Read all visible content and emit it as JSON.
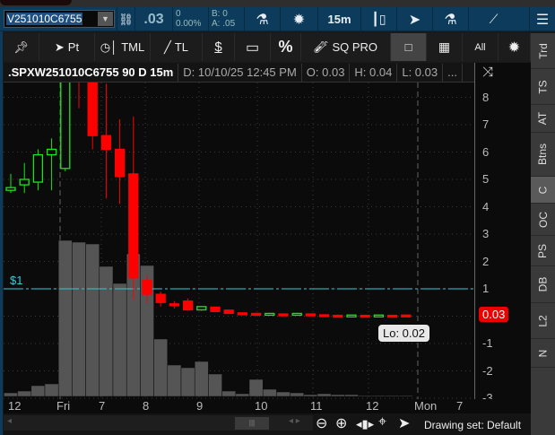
{
  "toolbar": {
    "symbol": "V251010C6755",
    "last": ".03",
    "change": "0",
    "change_pct": "0.00%",
    "bid": "B: 0",
    "ask": "A: .05",
    "timeframe": "15m"
  },
  "drawing_toolbar": {
    "pt": "Pt",
    "tml": "TML",
    "tl": "TL",
    "price_level": "$",
    "percent": "%",
    "sq_pro": "SQ PRO",
    "all": "All"
  },
  "side_tabs": [
    "Trd",
    "TS",
    "AT",
    "Btns",
    "C",
    "OC",
    "PS",
    "DB",
    "L2",
    "N"
  ],
  "header": {
    "title": ".SPXW251010C6755 90 D 15m",
    "date": "D: 10/10/25 12:45 PM",
    "open": "O: 0.03",
    "high": "H: 0.04",
    "low": "L: 0.03",
    "more": "..."
  },
  "chart_data": {
    "type": "candlestick",
    "price_ticks": [
      "8",
      "7",
      "6",
      "5",
      "4",
      "3",
      "2",
      "1",
      "0",
      "-1",
      "-2",
      "-3"
    ],
    "x_ticks": [
      "12",
      "Fri",
      "7",
      "8",
      "9",
      "10",
      "11",
      "12",
      "Mon",
      "7"
    ],
    "price_line_label": "$1",
    "price_line_value": 1,
    "last_price_label": "0.03",
    "low_tooltip": "Lo: 0.02",
    "candles": [
      [
        4.6,
        4.7,
        5.2,
        4.5
      ],
      [
        4.8,
        5.0,
        5.6,
        4.5
      ],
      [
        4.9,
        5.9,
        6.1,
        4.6
      ],
      [
        5.9,
        6.1,
        6.5,
        4.6
      ],
      [
        5.4,
        9.5,
        9.6,
        5.3
      ],
      [
        10,
        9.6,
        10.2,
        7.6
      ],
      [
        9.2,
        6.6,
        9.4,
        6.1
      ],
      [
        6.6,
        6.1,
        8.5,
        4.3
      ],
      [
        6.1,
        5.1,
        7.2,
        4.1
      ],
      [
        5.2,
        1.4,
        7.3,
        0.6
      ],
      [
        1.3,
        0.8,
        1.5,
        0.5
      ],
      [
        0.8,
        0.5,
        0.9,
        0.35
      ],
      [
        0.45,
        0.45,
        0.55,
        0.28
      ],
      [
        0.55,
        0.23,
        0.65,
        0.2
      ],
      [
        0.23,
        0.35,
        0.35,
        0.2
      ],
      [
        0.33,
        0.17,
        0.33,
        0.15
      ],
      [
        0.22,
        0.1,
        0.22,
        0.1
      ],
      [
        0.12,
        0.08,
        0.12,
        0.08
      ],
      [
        0.1,
        0.05,
        0.12,
        0.04
      ],
      [
        0.06,
        0.1,
        0.1,
        0.05
      ],
      [
        0.08,
        0.08,
        0.1,
        0.05
      ],
      [
        0.06,
        0.1,
        0.1,
        0.06
      ],
      [
        0.08,
        0.04,
        0.1,
        0.03
      ],
      [
        0.05,
        0.02,
        0.07,
        0.02
      ],
      [
        0.03,
        0.03,
        0.06,
        0.03
      ],
      [
        0.02,
        0.04,
        0.04,
        0.02
      ],
      [
        0.03,
        0.03,
        0.03,
        0.02
      ],
      [
        0.02,
        0.04,
        0.04,
        0.02
      ],
      [
        0.03,
        0.03,
        0.03,
        0.03
      ],
      [
        0.04,
        0.03,
        0.04,
        0.03
      ]
    ],
    "volume": [
      4,
      6,
      12,
      14,
      174,
      172,
      170,
      145,
      126,
      159,
      146,
      64,
      35,
      32,
      39,
      25,
      6,
      3,
      19,
      8,
      5,
      4,
      2,
      3,
      2,
      2,
      1,
      1,
      1,
      1
    ],
    "colors": {
      "up": "#19e619",
      "down": "#ff0000",
      "flat": "#bbbbbb",
      "volume": "#555555",
      "price_line": "#33ccdd"
    }
  },
  "bottom": {
    "drawing_set": "Drawing set: Default"
  }
}
